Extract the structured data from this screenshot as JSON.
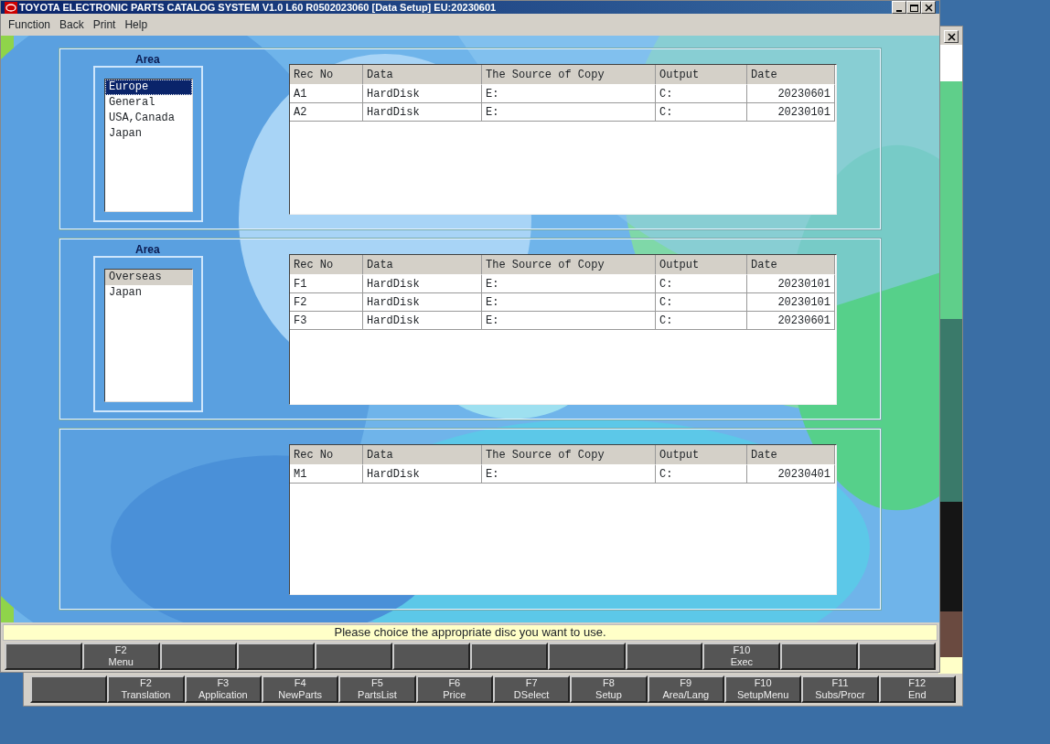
{
  "window": {
    "title": "TOYOTA ELECTRONIC PARTS CATALOG SYSTEM V1.0 L60 R0502023060 [Data Setup] EU:20230601"
  },
  "menu": [
    "Function",
    "Back",
    "Print",
    "Help"
  ],
  "panels": [
    {
      "list": {
        "label": "Area",
        "focused": true,
        "items": [
          {
            "label": "Europe",
            "selected": true
          },
          {
            "label": "General",
            "selected": false
          },
          {
            "label": "USA,Canada",
            "selected": false
          },
          {
            "label": "Japan",
            "selected": false
          }
        ]
      },
      "table": {
        "columns": [
          "Rec No",
          "Data",
          "The Source of Copy",
          "Output",
          "Date"
        ],
        "rows": [
          [
            "A1",
            "HardDisk",
            "E:",
            "C:",
            "20230601"
          ],
          [
            "A2",
            "HardDisk",
            "E:",
            "C:",
            "20230101"
          ]
        ]
      }
    },
    {
      "list": {
        "label": "Area",
        "focused": false,
        "items": [
          {
            "label": "Overseas",
            "selected": true
          },
          {
            "label": "Japan",
            "selected": false
          }
        ]
      },
      "table": {
        "columns": [
          "Rec No",
          "Data",
          "The Source of Copy",
          "Output",
          "Date"
        ],
        "rows": [
          [
            "F1",
            "HardDisk",
            "E:",
            "C:",
            "20230101"
          ],
          [
            "F2",
            "HardDisk",
            "E:",
            "C:",
            "20230101"
          ],
          [
            "F3",
            "HardDisk",
            "E:",
            "C:",
            "20230601"
          ]
        ]
      }
    },
    {
      "table": {
        "columns": [
          "Rec No",
          "Data",
          "The Source of Copy",
          "Output",
          "Date"
        ],
        "rows": [
          [
            "M1",
            "HardDisk",
            "E:",
            "C:",
            "20230401"
          ]
        ]
      }
    }
  ],
  "status_bar": "Please choice the appropriate disc you want to use.",
  "function_keys": [
    {
      "kind": "blank"
    },
    {
      "kind": "key",
      "key": "F2",
      "label": "Menu"
    },
    {
      "kind": "blank"
    },
    {
      "kind": "blank"
    },
    {
      "kind": "blank"
    },
    {
      "kind": "blank"
    },
    {
      "kind": "blank"
    },
    {
      "kind": "blank"
    },
    {
      "kind": "blank"
    },
    {
      "kind": "key",
      "key": "F10",
      "label": "Exec"
    },
    {
      "kind": "blank"
    },
    {
      "kind": "blank"
    }
  ],
  "background_window": {
    "function_keys": [
      {
        "kind": "blank"
      },
      {
        "kind": "key",
        "key": "F2",
        "label": "Translation"
      },
      {
        "kind": "key",
        "key": "F3",
        "label": "Application"
      },
      {
        "kind": "key",
        "key": "F4",
        "label": "NewParts"
      },
      {
        "kind": "key",
        "key": "F5",
        "label": "PartsList"
      },
      {
        "kind": "key",
        "key": "F6",
        "label": "Price"
      },
      {
        "kind": "key",
        "key": "F7",
        "label": "DSelect"
      },
      {
        "kind": "key",
        "key": "F8",
        "label": "Setup"
      },
      {
        "kind": "key",
        "key": "F9",
        "label": "Area/Lang"
      },
      {
        "kind": "key",
        "key": "F10",
        "label": "SetupMenu"
      },
      {
        "kind": "key",
        "key": "F11",
        "label": "Subs/Procr"
      },
      {
        "kind": "key",
        "key": "F12",
        "label": "End"
      }
    ]
  }
}
